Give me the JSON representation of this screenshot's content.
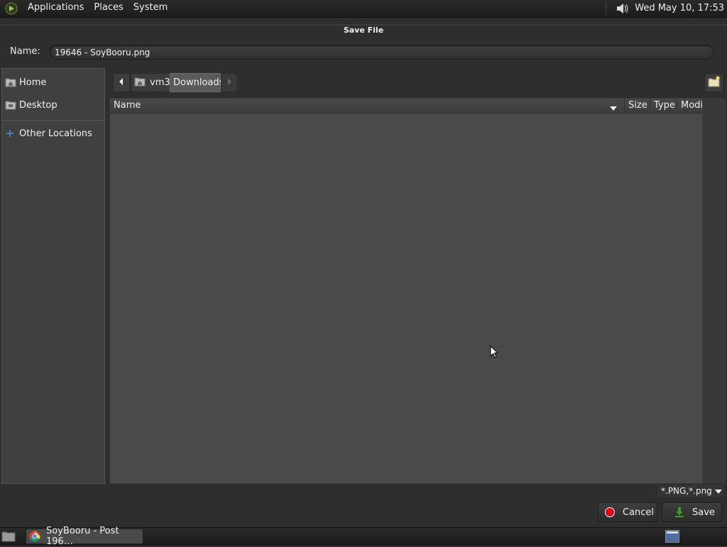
{
  "top_panel": {
    "menus": [
      "Applications",
      "Places",
      "System"
    ],
    "clock": "Wed May 10, 17:53",
    "icons": [
      "distro-logo-icon",
      "volume-icon"
    ]
  },
  "dialog": {
    "title": "Save File",
    "name_label": "Name:",
    "name_value": "19646 - SoyBooru.png"
  },
  "sidebar": {
    "items": [
      {
        "label": "Home",
        "icon": "home-folder-icon"
      },
      {
        "label": "Desktop",
        "icon": "desktop-folder-icon"
      },
      {
        "label": "Other Locations",
        "icon": "plus-icon"
      }
    ]
  },
  "pathbar": {
    "segments": [
      "vm3",
      "Downloads"
    ],
    "active": "Downloads"
  },
  "file_list": {
    "columns": [
      "Name",
      "Size",
      "Type",
      "Modified"
    ],
    "rows": []
  },
  "filter": {
    "selected": "*.PNG,*.png"
  },
  "buttons": {
    "cancel": "Cancel",
    "save": "Save"
  },
  "taskbar": {
    "task_label": "SoyBooru - Post 196…"
  },
  "colors": {
    "panel": "#1f1f1f",
    "dialog_bg": "#2e2e2e",
    "list_bg": "#4a4a4a",
    "active_segment": "#5a5a5a",
    "cancel_icon": "#e0001a",
    "save_icon": "#3aa02a"
  }
}
